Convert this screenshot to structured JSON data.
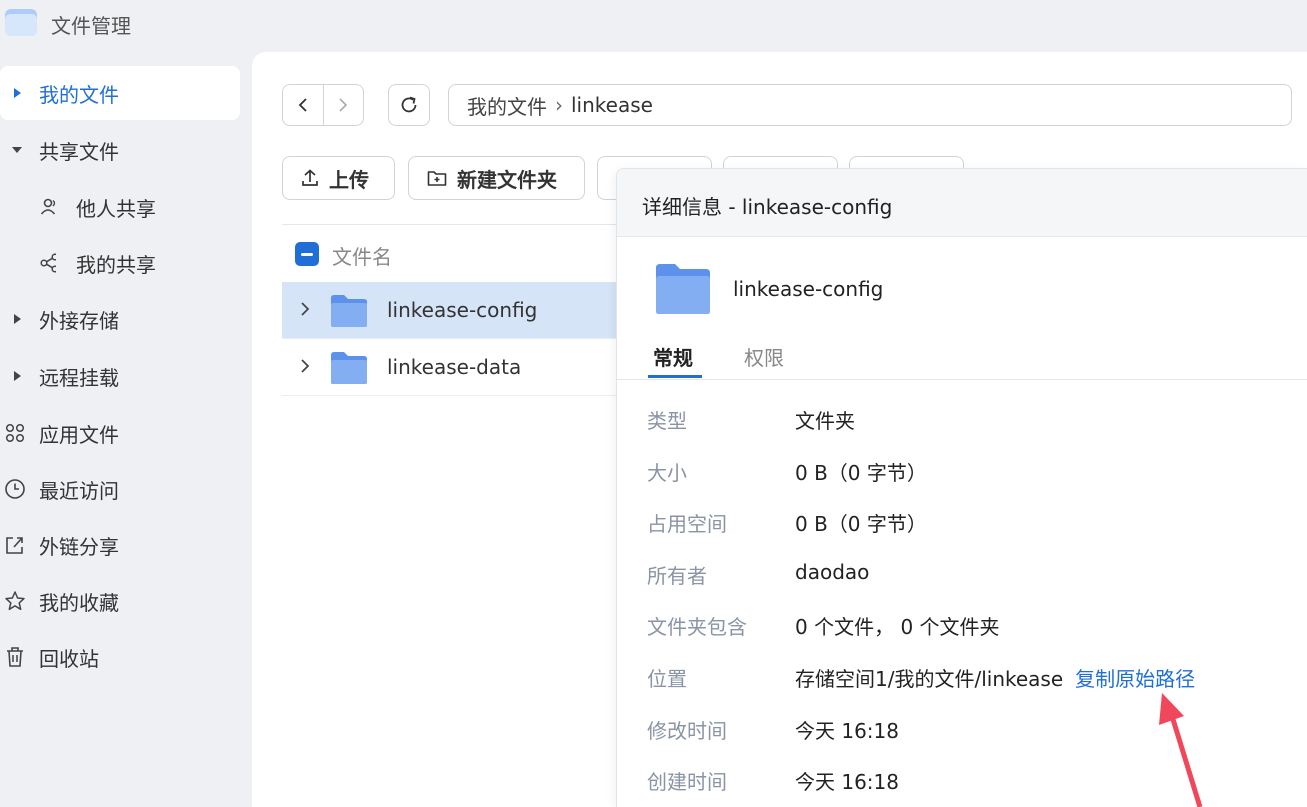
{
  "app": {
    "title": "文件管理"
  },
  "sidebar": {
    "items": [
      {
        "label": "我的文件",
        "icon": "caret-right-icon"
      },
      {
        "label": "共享文件",
        "icon": "caret-down-icon"
      },
      {
        "label": "他人共享",
        "icon": "users-icon"
      },
      {
        "label": "我的共享",
        "icon": "share-icon"
      },
      {
        "label": "外接存储",
        "icon": "caret-right-icon"
      },
      {
        "label": "远程挂载",
        "icon": "caret-right-icon"
      },
      {
        "label": "应用文件",
        "icon": "apps-icon"
      },
      {
        "label": "最近访问",
        "icon": "clock-icon"
      },
      {
        "label": "外链分享",
        "icon": "external-share-icon"
      },
      {
        "label": "我的收藏",
        "icon": "star-icon"
      },
      {
        "label": "回收站",
        "icon": "trash-icon"
      }
    ]
  },
  "pathbar": {
    "root": "我的文件",
    "separator": "›",
    "current": "linkease"
  },
  "toolbar": {
    "upload": "上传",
    "new_folder": "新建文件夹"
  },
  "list": {
    "column_name": "文件名",
    "rows": [
      {
        "name": "linkease-config"
      },
      {
        "name": "linkease-data"
      }
    ]
  },
  "detail": {
    "title": "详细信息 - linkease-config",
    "name": "linkease-config",
    "tabs": [
      "常规",
      "权限"
    ],
    "props": [
      {
        "key": "类型",
        "value": "文件夹"
      },
      {
        "key": "大小",
        "value": "0 B（0 字节）"
      },
      {
        "key": "占用空间",
        "value": "0 B（0 字节）"
      },
      {
        "key": "所有者",
        "value": "daodao"
      },
      {
        "key": "文件夹包含",
        "value": "0 个文件， 0 个文件夹"
      },
      {
        "key": "位置",
        "value": "存储空间1/我的文件/linkease",
        "link": "复制原始路径"
      },
      {
        "key": "修改时间",
        "value": "今天 16:18"
      },
      {
        "key": "创建时间",
        "value": "今天 16:18"
      }
    ]
  },
  "colors": {
    "accent": "#1f6fd6",
    "folder": "#7aaaf0",
    "arrow": "#f0475a"
  }
}
